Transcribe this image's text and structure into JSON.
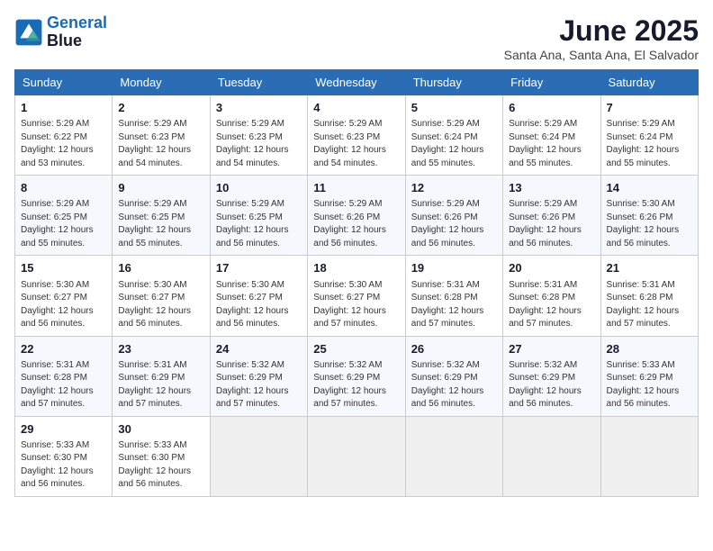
{
  "app": {
    "name": "GeneralBlue",
    "logo_line1": "General",
    "logo_line2": "Blue"
  },
  "calendar": {
    "month": "June 2025",
    "location": "Santa Ana, Santa Ana, El Salvador",
    "headers": [
      "Sunday",
      "Monday",
      "Tuesday",
      "Wednesday",
      "Thursday",
      "Friday",
      "Saturday"
    ],
    "weeks": [
      [
        {
          "day": "",
          "empty": true
        },
        {
          "day": "2",
          "sunrise": "5:29 AM",
          "sunset": "6:23 PM",
          "daylight": "12 hours and 54 minutes."
        },
        {
          "day": "3",
          "sunrise": "5:29 AM",
          "sunset": "6:23 PM",
          "daylight": "12 hours and 54 minutes."
        },
        {
          "day": "4",
          "sunrise": "5:29 AM",
          "sunset": "6:23 PM",
          "daylight": "12 hours and 54 minutes."
        },
        {
          "day": "5",
          "sunrise": "5:29 AM",
          "sunset": "6:24 PM",
          "daylight": "12 hours and 55 minutes."
        },
        {
          "day": "6",
          "sunrise": "5:29 AM",
          "sunset": "6:24 PM",
          "daylight": "12 hours and 55 minutes."
        },
        {
          "day": "7",
          "sunrise": "5:29 AM",
          "sunset": "6:24 PM",
          "daylight": "12 hours and 55 minutes."
        }
      ],
      [
        {
          "day": "1",
          "sunrise": "5:29 AM",
          "sunset": "6:22 PM",
          "daylight": "12 hours and 53 minutes."
        },
        {
          "day": "9",
          "sunrise": "5:29 AM",
          "sunset": "6:25 PM",
          "daylight": "12 hours and 55 minutes."
        },
        {
          "day": "10",
          "sunrise": "5:29 AM",
          "sunset": "6:25 PM",
          "daylight": "12 hours and 56 minutes."
        },
        {
          "day": "11",
          "sunrise": "5:29 AM",
          "sunset": "6:26 PM",
          "daylight": "12 hours and 56 minutes."
        },
        {
          "day": "12",
          "sunrise": "5:29 AM",
          "sunset": "6:26 PM",
          "daylight": "12 hours and 56 minutes."
        },
        {
          "day": "13",
          "sunrise": "5:29 AM",
          "sunset": "6:26 PM",
          "daylight": "12 hours and 56 minutes."
        },
        {
          "day": "14",
          "sunrise": "5:30 AM",
          "sunset": "6:26 PM",
          "daylight": "12 hours and 56 minutes."
        }
      ],
      [
        {
          "day": "8",
          "sunrise": "5:29 AM",
          "sunset": "6:25 PM",
          "daylight": "12 hours and 55 minutes."
        },
        {
          "day": "16",
          "sunrise": "5:30 AM",
          "sunset": "6:27 PM",
          "daylight": "12 hours and 56 minutes."
        },
        {
          "day": "17",
          "sunrise": "5:30 AM",
          "sunset": "6:27 PM",
          "daylight": "12 hours and 56 minutes."
        },
        {
          "day": "18",
          "sunrise": "5:30 AM",
          "sunset": "6:27 PM",
          "daylight": "12 hours and 57 minutes."
        },
        {
          "day": "19",
          "sunrise": "5:31 AM",
          "sunset": "6:28 PM",
          "daylight": "12 hours and 57 minutes."
        },
        {
          "day": "20",
          "sunrise": "5:31 AM",
          "sunset": "6:28 PM",
          "daylight": "12 hours and 57 minutes."
        },
        {
          "day": "21",
          "sunrise": "5:31 AM",
          "sunset": "6:28 PM",
          "daylight": "12 hours and 57 minutes."
        }
      ],
      [
        {
          "day": "15",
          "sunrise": "5:30 AM",
          "sunset": "6:27 PM",
          "daylight": "12 hours and 56 minutes."
        },
        {
          "day": "23",
          "sunrise": "5:31 AM",
          "sunset": "6:29 PM",
          "daylight": "12 hours and 57 minutes."
        },
        {
          "day": "24",
          "sunrise": "5:32 AM",
          "sunset": "6:29 PM",
          "daylight": "12 hours and 57 minutes."
        },
        {
          "day": "25",
          "sunrise": "5:32 AM",
          "sunset": "6:29 PM",
          "daylight": "12 hours and 57 minutes."
        },
        {
          "day": "26",
          "sunrise": "5:32 AM",
          "sunset": "6:29 PM",
          "daylight": "12 hours and 56 minutes."
        },
        {
          "day": "27",
          "sunrise": "5:32 AM",
          "sunset": "6:29 PM",
          "daylight": "12 hours and 56 minutes."
        },
        {
          "day": "28",
          "sunrise": "5:33 AM",
          "sunset": "6:29 PM",
          "daylight": "12 hours and 56 minutes."
        }
      ],
      [
        {
          "day": "22",
          "sunrise": "5:31 AM",
          "sunset": "6:28 PM",
          "daylight": "12 hours and 57 minutes."
        },
        {
          "day": "30",
          "sunrise": "5:33 AM",
          "sunset": "6:30 PM",
          "daylight": "12 hours and 56 minutes."
        },
        {
          "day": "",
          "empty": true
        },
        {
          "day": "",
          "empty": true
        },
        {
          "day": "",
          "empty": true
        },
        {
          "day": "",
          "empty": true
        },
        {
          "day": "",
          "empty": true
        }
      ],
      [
        {
          "day": "29",
          "sunrise": "5:33 AM",
          "sunset": "6:30 PM",
          "daylight": "12 hours and 56 minutes."
        },
        {
          "day": "",
          "empty": true
        },
        {
          "day": "",
          "empty": true
        },
        {
          "day": "",
          "empty": true
        },
        {
          "day": "",
          "empty": true
        },
        {
          "day": "",
          "empty": true
        },
        {
          "day": "",
          "empty": true
        }
      ]
    ]
  }
}
